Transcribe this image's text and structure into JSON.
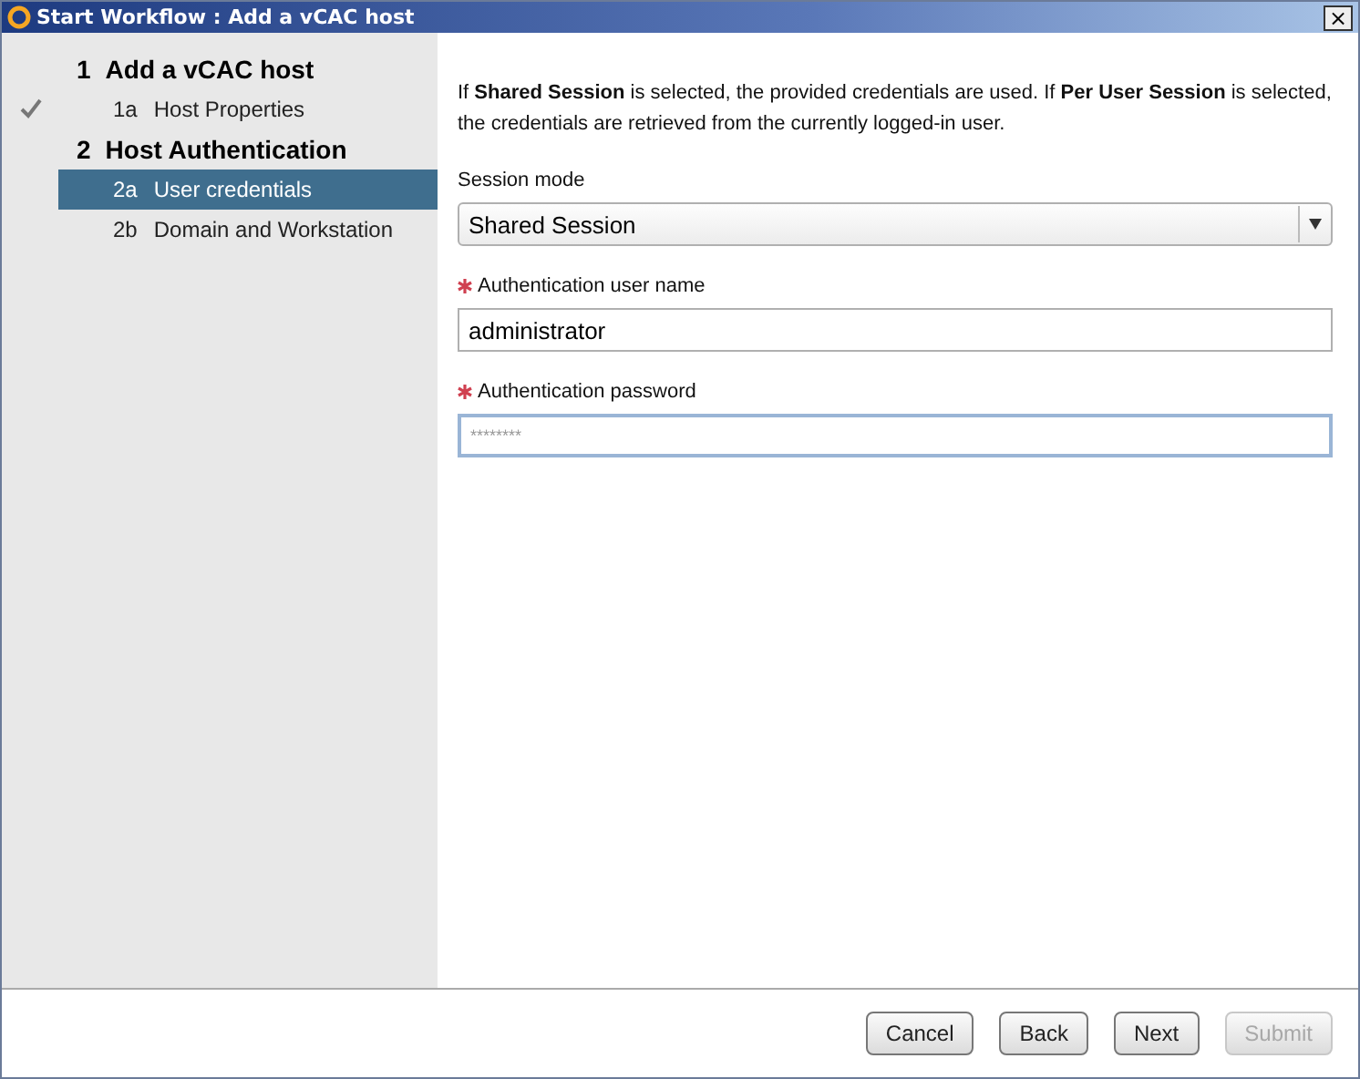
{
  "window": {
    "title": "Start Workflow : Add a vCAC host",
    "close": "×"
  },
  "steps": [
    {
      "number": "1",
      "label": "Add a vCAC host",
      "children": [
        {
          "number": "1a",
          "label": "Host Properties",
          "done": true,
          "selected": false
        }
      ]
    },
    {
      "number": "2",
      "label": "Host Authentication",
      "children": [
        {
          "number": "2a",
          "label": "User credentials",
          "done": false,
          "selected": true
        },
        {
          "number": "2b",
          "label": "Domain and Workstation",
          "done": false,
          "selected": false
        }
      ]
    }
  ],
  "intro": "If **Shared Session** is selected, the provided credentials are used.  If **Per User Session** is selected, the credentials are retrieved from the currently logged-in user.",
  "fields": [
    {
      "kind": "select",
      "label": "Session mode",
      "required": false,
      "value": "Shared Session",
      "focused": false
    },
    {
      "kind": "text",
      "label": "Authentication user name",
      "required": true,
      "value": "administrator",
      "focused": false
    },
    {
      "kind": "password",
      "label": "Authentication password",
      "required": true,
      "placeholder": "********",
      "focused": true
    }
  ],
  "buttons": [
    {
      "label": "Cancel",
      "disabled": false
    },
    {
      "label": "Back",
      "disabled": false
    },
    {
      "label": "Next",
      "disabled": false
    },
    {
      "label": "Submit",
      "disabled": true
    }
  ]
}
